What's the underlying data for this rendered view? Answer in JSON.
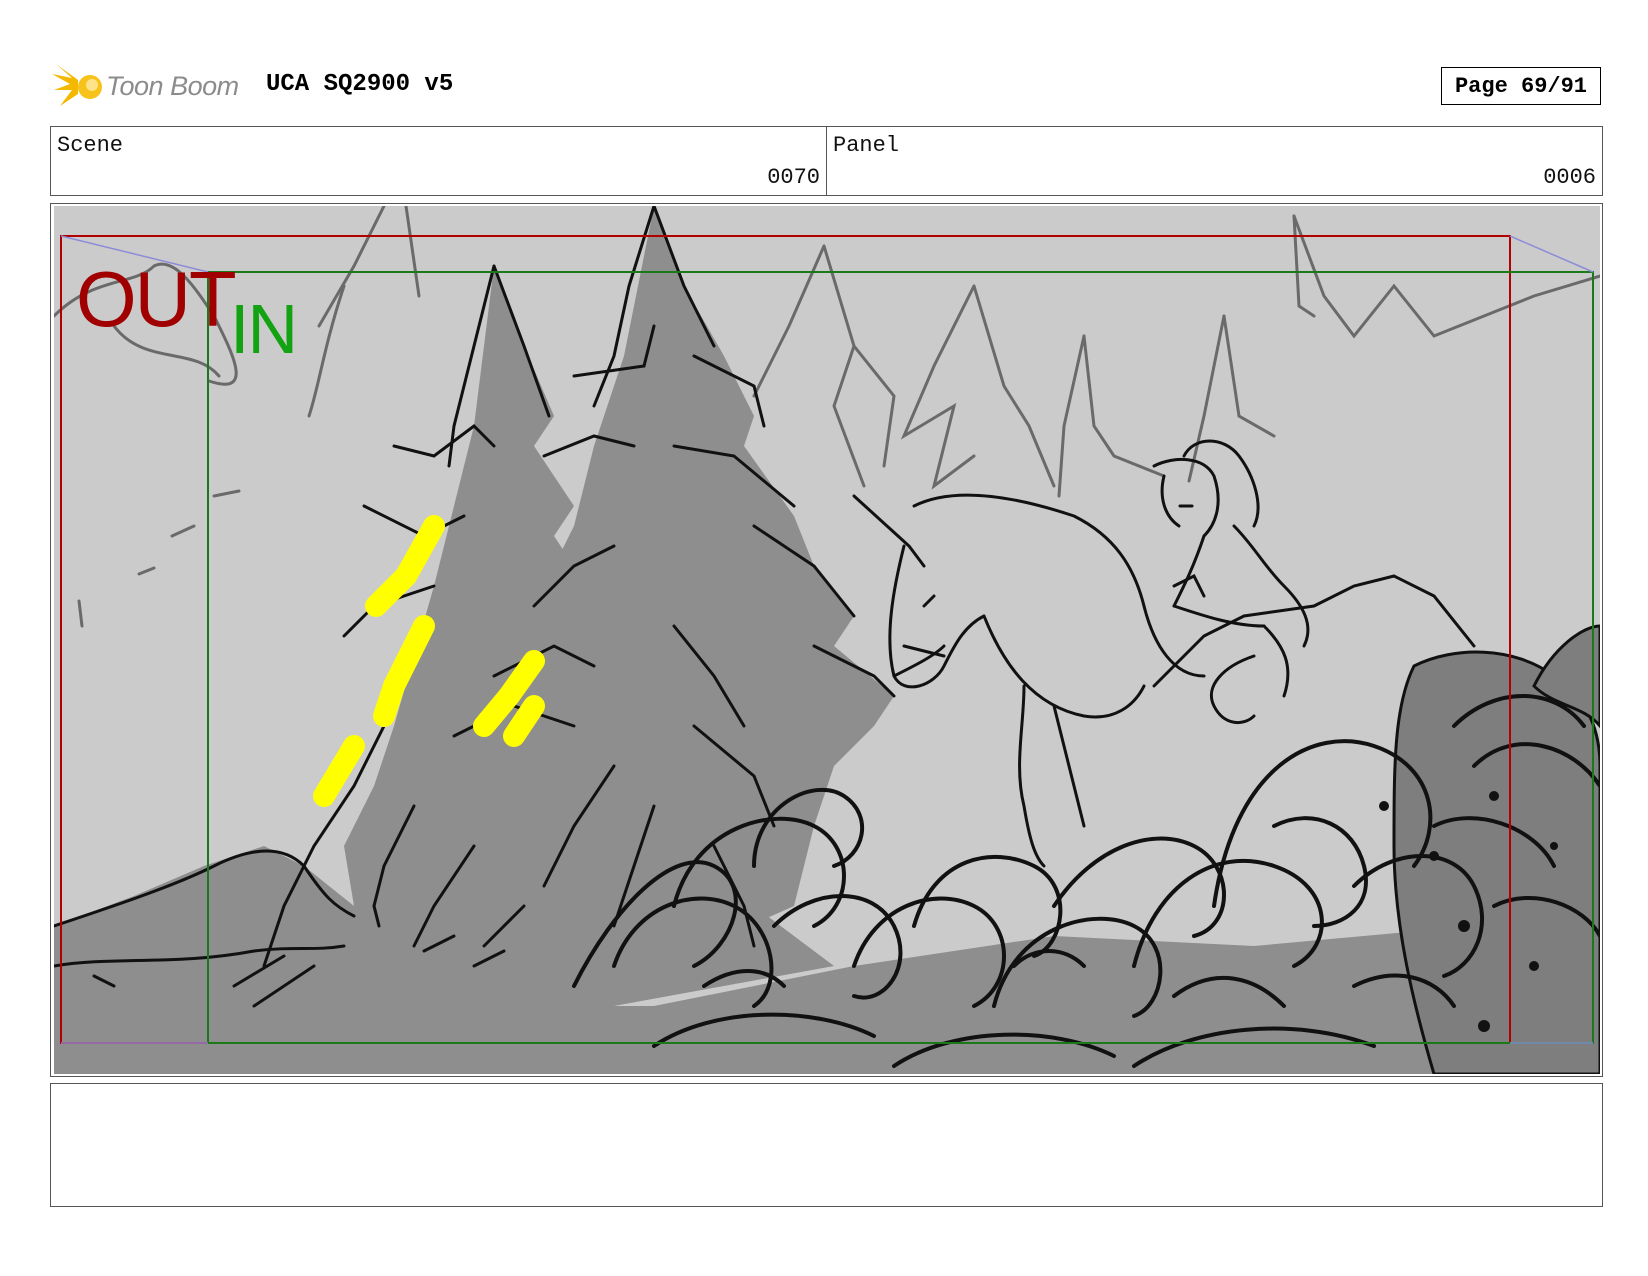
{
  "header": {
    "logo_text": "Toon Boom",
    "project_title": "UCA SQ2900 v5",
    "page_label": "Page 69/91"
  },
  "info": {
    "scene_label": "Scene",
    "scene_value": "0070",
    "panel_label": "Panel",
    "panel_value": "0006"
  },
  "panel": {
    "out_label": "OUT",
    "in_label": "IN",
    "out_frame_color": "#b00000",
    "in_frame_color": "#1a7a1a",
    "highlight_color": "#ffff00"
  },
  "notes": {
    "text": ""
  }
}
